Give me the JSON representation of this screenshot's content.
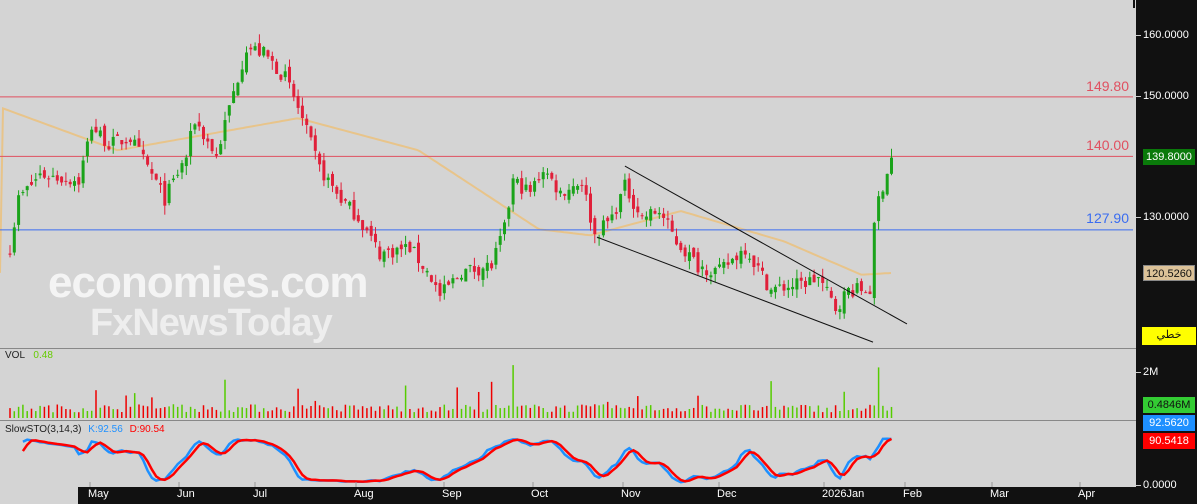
{
  "chart_data": {
    "type": "candlestick",
    "title": "",
    "price_axis": {
      "ticks": [
        "160.0000",
        "150.0000",
        "130.0000"
      ],
      "ylim": [
        108,
        166
      ]
    },
    "time_axis": {
      "months": [
        "May",
        "Jun",
        "Jul",
        "Aug",
        "Sep",
        "Oct",
        "Nov",
        "Dec",
        "2026Jan",
        "Feb",
        "Mar",
        "Apr"
      ]
    },
    "close_keypoints": [
      [
        0,
        125
      ],
      [
        2,
        133
      ],
      [
        7,
        137
      ],
      [
        16,
        136
      ],
      [
        19,
        145
      ],
      [
        23,
        142
      ],
      [
        28,
        143
      ],
      [
        33,
        137
      ],
      [
        36,
        133
      ],
      [
        41,
        140
      ],
      [
        43,
        146
      ],
      [
        48,
        140
      ],
      [
        51,
        148
      ],
      [
        55,
        158
      ],
      [
        59,
        157
      ],
      [
        64,
        153
      ],
      [
        67,
        148
      ],
      [
        72,
        138
      ],
      [
        77,
        133
      ],
      [
        81,
        130
      ],
      [
        86,
        124
      ],
      [
        93,
        125
      ],
      [
        98,
        120
      ],
      [
        100,
        117
      ],
      [
        105,
        121
      ],
      [
        112,
        122
      ],
      [
        115,
        128
      ],
      [
        117,
        136
      ],
      [
        121,
        134
      ],
      [
        124,
        138
      ],
      [
        128,
        134
      ],
      [
        133,
        136
      ],
      [
        136,
        127
      ],
      [
        140,
        130
      ],
      [
        143,
        135
      ],
      [
        147,
        130
      ],
      [
        151,
        131
      ],
      [
        155,
        126
      ],
      [
        160,
        122
      ],
      [
        165,
        121
      ],
      [
        171,
        125
      ],
      [
        177,
        118
      ],
      [
        184,
        119
      ],
      [
        188,
        120
      ],
      [
        192,
        115
      ],
      [
        195,
        118
      ],
      [
        200,
        118
      ],
      [
        201,
        128
      ],
      [
        202,
        133
      ],
      [
        205,
        139.8
      ]
    ],
    "moving_average": {
      "value_label": "120.5260",
      "keypoints": [
        [
          -2,
          148
        ],
        [
          25,
          141
        ],
        [
          67,
          146.3
        ],
        [
          95,
          141
        ],
        [
          123,
          128
        ],
        [
          135,
          127
        ],
        [
          156,
          131
        ],
        [
          180,
          126
        ],
        [
          198,
          120.5
        ],
        [
          205,
          120.8
        ]
      ]
    },
    "levels": [
      {
        "value": 149.8,
        "label": "149.80",
        "color": "#e05060"
      },
      {
        "value": 140.0,
        "label": "140.00",
        "color": "#e05060"
      },
      {
        "value": 127.9,
        "label": "127.90",
        "color": "#3a6cf0"
      }
    ],
    "trendlines": [
      {
        "from": [
          143,
          138.4
        ],
        "to": [
          208.6,
          112.4
        ]
      },
      {
        "from": [
          136.5,
          126.7
        ],
        "to": [
          200.7,
          109.4
        ]
      }
    ],
    "last_price": "139.8000",
    "volume": {
      "title": "VOL",
      "value": "0.48",
      "last_label": "0.4846M",
      "ticks": [
        "2M",
        "0.0000"
      ]
    },
    "stochastic": {
      "title": "SlowSTO(3,14,3)",
      "k_label": "K:92.56",
      "d_label": "D:90.54",
      "k_value": "92.5620",
      "d_value": "90.5418",
      "k_color": "#1e90ff",
      "d_color": "#ff0000"
    },
    "style_tag": "خطي"
  },
  "watermark": {
    "line1": "economies.com",
    "line2": "FxNewsToday"
  },
  "colors": {
    "up": "#1aa31a",
    "down": "#e0203a",
    "ma": "#e8c48a"
  }
}
